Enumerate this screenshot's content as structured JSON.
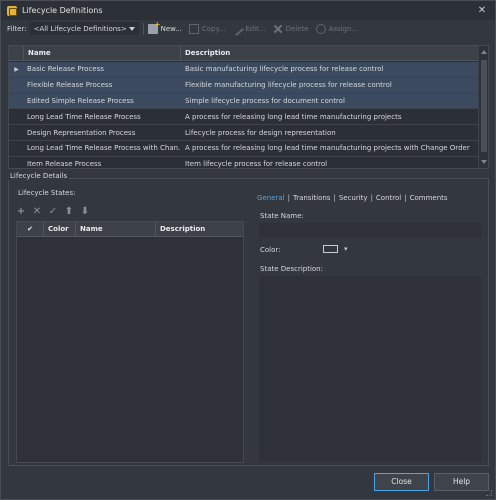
{
  "window": {
    "title": "Lifecycle Definitions"
  },
  "toolbar": {
    "filter_label": "Filter:",
    "filter_value": "<All Lifecycle Definitions>",
    "new_label": "New...",
    "copy_label": "Copy...",
    "edit_label": "Edit...",
    "delete_label": "Delete",
    "assign_label": "Assign..."
  },
  "grid": {
    "columns": [
      "Name",
      "Description"
    ],
    "rows": [
      {
        "name": "Basic Release Process",
        "description": "Basic manufacturing lifecycle process for release control"
      },
      {
        "name": "Flexible Release Process",
        "description": "Flexible manufacturing lifecycle process for release control"
      },
      {
        "name": "Edited Simple Release Process",
        "description": "Simple lifecycle process for document control"
      },
      {
        "name": "Long Lead Time Release Process",
        "description": "A process for releasing long lead time manufacturing projects"
      },
      {
        "name": "Design Representation Process",
        "description": "Lifecycle process for design representation"
      },
      {
        "name": "Long Lead Time Release Process with Chan...",
        "description": "A process for releasing long lead time manufacturing projects with Change Order"
      },
      {
        "name": "Item Release Process",
        "description": "Item lifecycle process for release control"
      }
    ]
  },
  "details": {
    "group_label": "Lifecycle Details",
    "states_label": "Lifecycle States:",
    "states_columns": [
      "Color",
      "Name",
      "Description"
    ],
    "tabs": [
      "General",
      "Transitions",
      "Security",
      "Control",
      "Comments"
    ],
    "state_name_label": "State Name:",
    "color_label": "Color:",
    "state_description_label": "State Description:"
  },
  "buttons": {
    "close": "Close",
    "help": "Help"
  },
  "colors": {
    "accent": "#4aa6e8",
    "background": "#33373e",
    "selection": "#3b4a5e"
  }
}
